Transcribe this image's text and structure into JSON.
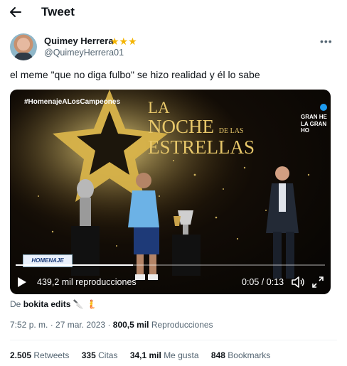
{
  "header": {
    "title": "Tweet"
  },
  "author": {
    "name": "Quimey Herrera",
    "badges": "★★★",
    "handle": "@QuimeyHerrera01"
  },
  "tweet": {
    "text": "el meme \"que no diga fulbo\" se hizo realidad y él lo sabe"
  },
  "media": {
    "hashtag": "#HomenajeALosCampeones",
    "title_line1": "LA",
    "title_line2": "NOCHE",
    "title_small": "DE LAS",
    "title_line3": "ESTRELLAS",
    "sponsor": "GRAN HE\nLA GRAN\nHO",
    "lower_third": "HOMENAJE",
    "views": "439,2 mil reproducciones",
    "time": "0:05 / 0:13",
    "progress": 0.38
  },
  "source": {
    "prefix": "De",
    "name": "bokita edits",
    "emoji": "🔪 🧜"
  },
  "meta": {
    "time": "7:52 p. m.",
    "date": "27 mar. 2023",
    "views_value": "800,5 mil",
    "views_label": "Reproducciones"
  },
  "stats": {
    "retweets_value": "2.505",
    "retweets_label": "Retweets",
    "quotes_value": "335",
    "quotes_label": "Citas",
    "likes_value": "34,1 mil",
    "likes_label": "Me gusta",
    "bookmarks_value": "848",
    "bookmarks_label": "Bookmarks"
  },
  "colors": {
    "accent": "#1d9bf0",
    "gold": "#e7c76a",
    "muted": "#536471",
    "badge": "#f4b400"
  },
  "icons": {
    "back": "arrow-left-icon",
    "more": "more-dots-icon",
    "play": "play-icon",
    "volume": "volume-icon",
    "fullscreen": "fullscreen-icon"
  }
}
